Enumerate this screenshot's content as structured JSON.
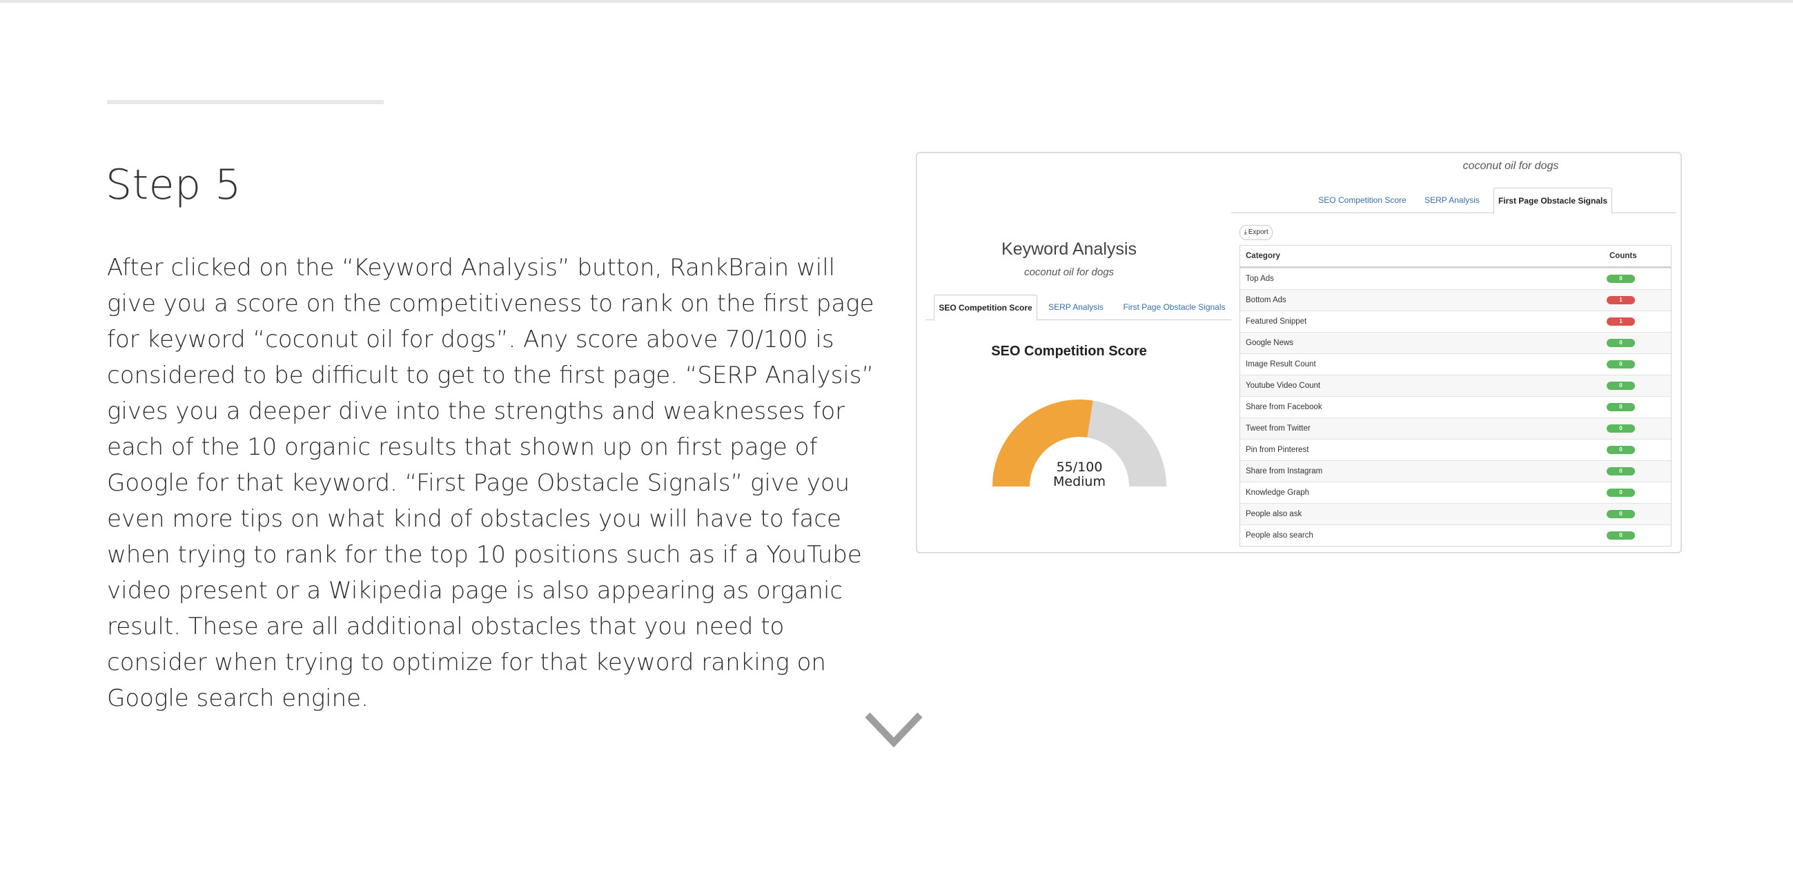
{
  "step": {
    "title": "Step 5",
    "body": "After clicked on the “Keyword Analysis” button, RankBrain will give you a score on the competitiveness to rank on the first page for keyword “coconut oil for dogs”. Any score above 70/100 is considered to be difficult to get to the first page. “SERP Analysis” gives you a deeper dive into the strengths and weaknesses for each of the 10 organic results that shown up on first page of Google for that keyword. “First Page Obstacle Signals” give you even more tips on what kind of obstacles you will have to face when trying to rank for the top 10 positions such as if a YouTube video present or a Wikipedia page is also appearing as organic result. These are all additional obstacles that you need to consider when trying to optimize for that keyword ranking on Google search engine."
  },
  "screenshot": {
    "keyword_top": "coconut oil for dogs",
    "tabs": [
      "SEO Competition Score",
      "SERP Analysis",
      "First Page Obstacle Signals"
    ],
    "active_tab_right": "First Page Obstacle Signals",
    "active_tab_left": "SEO Competition Score",
    "export_label": "Export",
    "export_icon": "download-icon",
    "table": {
      "headers": [
        "Category",
        "Counts"
      ],
      "rows": [
        {
          "category": "Top Ads",
          "count": "0",
          "status": "good"
        },
        {
          "category": "Bottom Ads",
          "count": "1",
          "status": "bad"
        },
        {
          "category": "Featured Snippet",
          "count": "1",
          "status": "bad"
        },
        {
          "category": "Google News",
          "count": "0",
          "status": "good"
        },
        {
          "category": "Image Result Count",
          "count": "0",
          "status": "good"
        },
        {
          "category": "Youtube Video Count",
          "count": "0",
          "status": "good"
        },
        {
          "category": "Share from Facebook",
          "count": "0",
          "status": "good"
        },
        {
          "category": "Tweet from Twitter",
          "count": "0",
          "status": "good"
        },
        {
          "category": "Pin from Pinterest",
          "count": "0",
          "status": "good"
        },
        {
          "category": "Share from Instagram",
          "count": "0",
          "status": "good"
        },
        {
          "category": "Knowledge Graph",
          "count": "0",
          "status": "good"
        },
        {
          "category": "People also ask",
          "count": "0",
          "status": "good"
        },
        {
          "category": "People also search",
          "count": "0",
          "status": "good"
        }
      ]
    },
    "keyword_analysis": {
      "title": "Keyword Analysis",
      "subtitle": "coconut oil for dogs",
      "score_title": "SEO Competition Score",
      "score": 55,
      "score_max": 100,
      "score_text": "55/100",
      "score_label": "Medium"
    }
  },
  "colors": {
    "gauge_fill": "#f0a43a",
    "gauge_track": "#d8d8d8",
    "badge_good": "#5cb85c",
    "badge_bad": "#d9534f",
    "link": "#3a6ea5",
    "chevron": "#9e9e9e"
  },
  "scroll_icon": "chevron-down-icon"
}
